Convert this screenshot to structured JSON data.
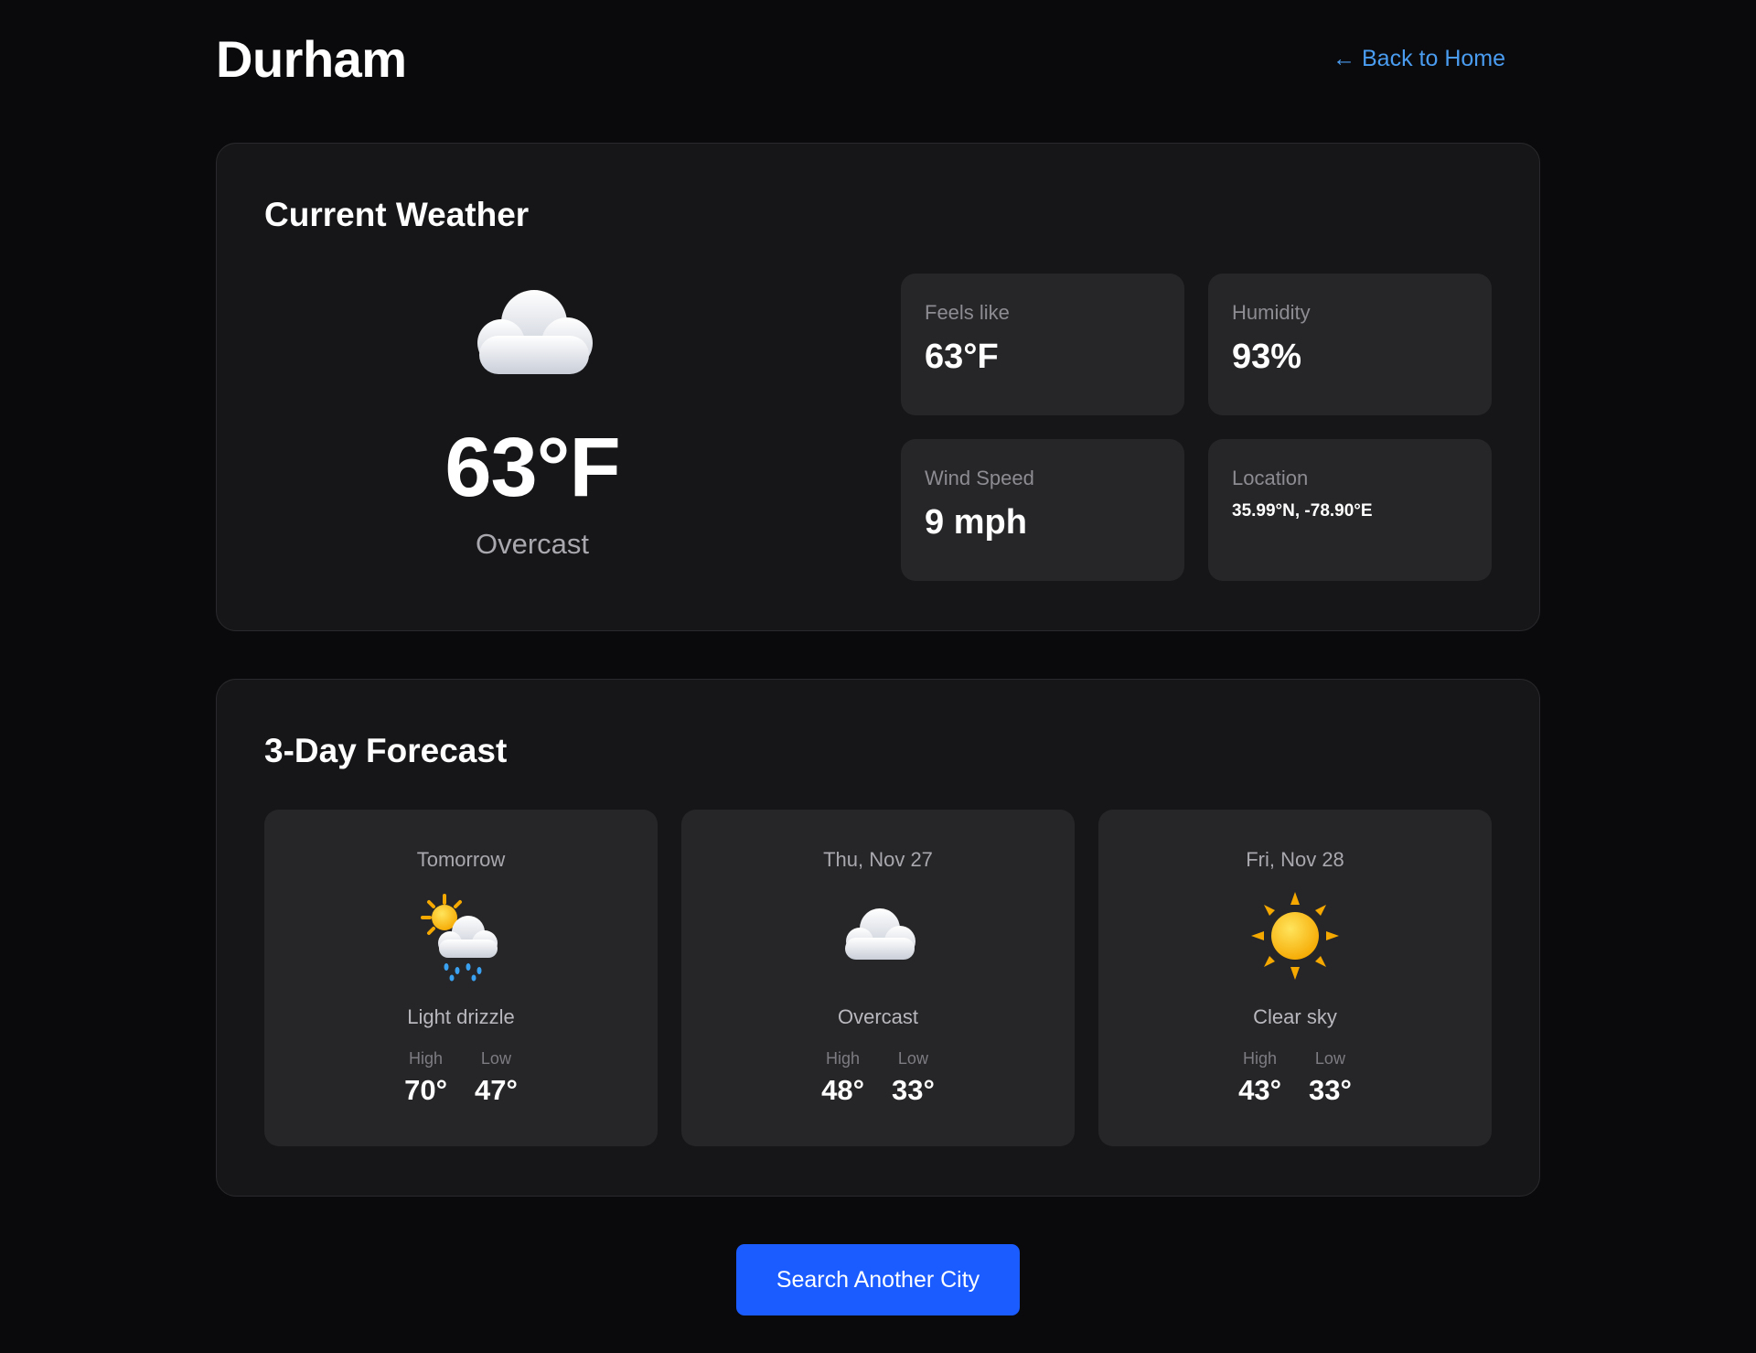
{
  "header": {
    "city": "Durham",
    "back_link": "← Back to Home"
  },
  "current": {
    "section_title": "Current Weather",
    "icon": "cloud-icon",
    "temperature": "63°F",
    "condition": "Overcast",
    "stats": [
      {
        "label": "Feels like",
        "value": "63°F"
      },
      {
        "label": "Humidity",
        "value": "93%"
      },
      {
        "label": "Wind Speed",
        "value": "9 mph"
      },
      {
        "label": "Location",
        "value": "35.99°N, -78.90°E"
      }
    ]
  },
  "forecast": {
    "section_title": "3-Day Forecast",
    "days": [
      {
        "day": "Tomorrow",
        "icon": "sun-rain-cloud-icon",
        "condition": "Light drizzle",
        "high_label": "High",
        "low_label": "Low",
        "high": "70°",
        "low": "47°"
      },
      {
        "day": "Thu, Nov 27",
        "icon": "cloud-icon",
        "condition": "Overcast",
        "high_label": "High",
        "low_label": "Low",
        "high": "48°",
        "low": "33°"
      },
      {
        "day": "Fri, Nov 28",
        "icon": "sun-icon",
        "condition": "Clear sky",
        "high_label": "High",
        "low_label": "Low",
        "high": "43°",
        "low": "33°"
      }
    ]
  },
  "actions": {
    "search_label": "Search Another City"
  },
  "colors": {
    "background": "#0a0a0c",
    "card": "#161618",
    "stat_box": "#262628",
    "link": "#4a9cf0",
    "button": "#1a5cff"
  }
}
